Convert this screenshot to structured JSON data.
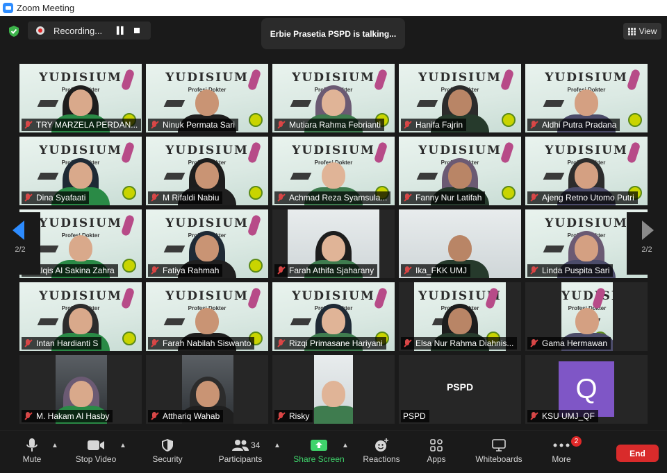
{
  "window": {
    "title": "Zoom Meeting"
  },
  "recording": {
    "label": "Recording..."
  },
  "talking": {
    "text": "Erbie Prasetia PSPD is talking..."
  },
  "view": {
    "label": "View"
  },
  "pagination": {
    "left": "2/2",
    "right": "2/2"
  },
  "participants_grid": [
    {
      "name": "TRY MARZELA PERDAN...",
      "muted": true,
      "bg": "yudisium"
    },
    {
      "name": "Ninuk Permata Sari",
      "muted": true,
      "bg": "yudisium"
    },
    {
      "name": "Mutiara Rahma Febrianti",
      "muted": true,
      "bg": "yudisium"
    },
    {
      "name": "Hanifa Fajrin",
      "muted": true,
      "bg": "yudisium"
    },
    {
      "name": "Aldhi Putra Pradana",
      "muted": true,
      "bg": "yudisium"
    },
    {
      "name": "Dina Syafaati",
      "muted": true,
      "bg": "yudisium"
    },
    {
      "name": "M Rifaldi Nabiu",
      "muted": true,
      "bg": "yudisium"
    },
    {
      "name": "Achmad Reza Syamsula...",
      "muted": true,
      "bg": "yudisium"
    },
    {
      "name": "Fanny Nur Latifah",
      "muted": true,
      "bg": "yudisium"
    },
    {
      "name": "Ajeng Retno Utomo Putri",
      "muted": true,
      "bg": "yudisium"
    },
    {
      "name": "alqis Al Sakina Zahra",
      "muted": true,
      "bg": "yudisium"
    },
    {
      "name": "Fatiya Rahmah",
      "muted": true,
      "bg": "yudisium"
    },
    {
      "name": "Farah Athifa Sjaharany",
      "muted": true,
      "bg": "room"
    },
    {
      "name": "Ika_FKK UMJ",
      "muted": true,
      "bg": "room"
    },
    {
      "name": "Linda Puspita Sari",
      "muted": true,
      "bg": "yudisium"
    },
    {
      "name": "Intan Hardianti S",
      "muted": true,
      "bg": "yudisium"
    },
    {
      "name": "Farah Nabilah Siswanto",
      "muted": true,
      "bg": "yudisium"
    },
    {
      "name": "Rizqi Primasane Hariyani",
      "muted": true,
      "bg": "yudisium"
    },
    {
      "name": "Elsa Nur Rahma Diahnis...",
      "muted": true,
      "bg": "yudisium"
    },
    {
      "name": "Gama Hermawan",
      "muted": true,
      "bg": "yudisium"
    },
    {
      "name": "M. Hakam Al Hasby",
      "muted": true,
      "bg": "car"
    },
    {
      "name": "Atthariq Wahab",
      "muted": true,
      "bg": "car"
    },
    {
      "name": "Risky",
      "muted": true,
      "bg": "room"
    },
    {
      "name": "PSPD",
      "muted": false,
      "bg": "text",
      "display_text": "PSPD"
    },
    {
      "name": "KSU UMJ_QF",
      "muted": true,
      "bg": "avatar",
      "avatar_letter": "Q"
    }
  ],
  "toolbar": {
    "mute": "Mute",
    "stop_video": "Stop Video",
    "security": "Security",
    "participants": "Participants",
    "participants_count": "34",
    "share_screen": "Share Screen",
    "reactions": "Reactions",
    "apps": "Apps",
    "whiteboards": "Whiteboards",
    "more": "More",
    "more_badge": "2",
    "end": "End"
  },
  "tile_background": {
    "yudisium_title": "YUDISIUM",
    "yudisium_subtitle": "Profesi Dokter"
  },
  "colors": {
    "accent": "#2d8cff",
    "share_green": "#3fd36b",
    "end_red": "#d92b2b",
    "avatar_purple": "#7f56c6",
    "muted_red": "#e04040"
  }
}
